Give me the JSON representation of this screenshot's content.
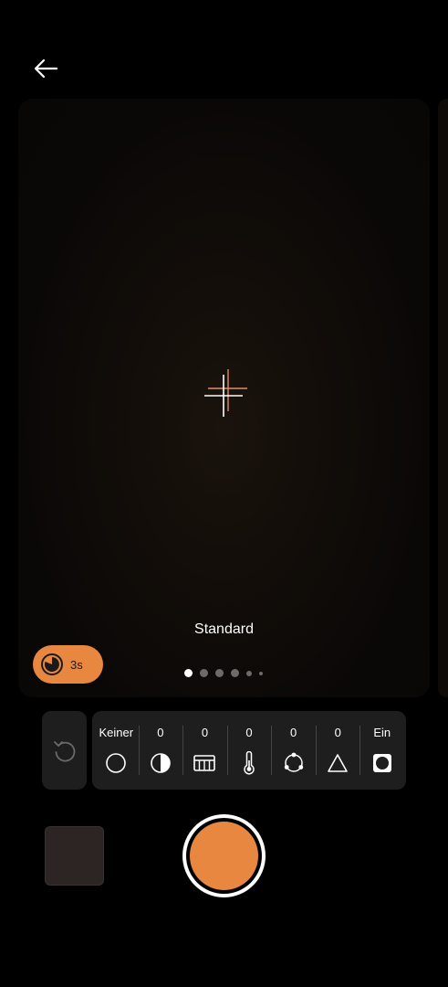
{
  "camera": {
    "mode_label": "Standard",
    "timer": {
      "label": "3s"
    },
    "page_dots": {
      "count": 6,
      "active_index": 0
    }
  },
  "adjustments": [
    {
      "value": "Keiner",
      "icon": "filter-none-icon"
    },
    {
      "value": "0",
      "icon": "contrast-icon"
    },
    {
      "value": "0",
      "icon": "sharpness-icon"
    },
    {
      "value": "0",
      "icon": "temperature-icon"
    },
    {
      "value": "0",
      "icon": "saturation-icon"
    },
    {
      "value": "0",
      "icon": "brightness-icon"
    },
    {
      "value": "Ein",
      "icon": "vignette-icon"
    }
  ],
  "colors": {
    "accent": "#e8873f",
    "panel": "#1e1e1e",
    "background": "#000000"
  }
}
